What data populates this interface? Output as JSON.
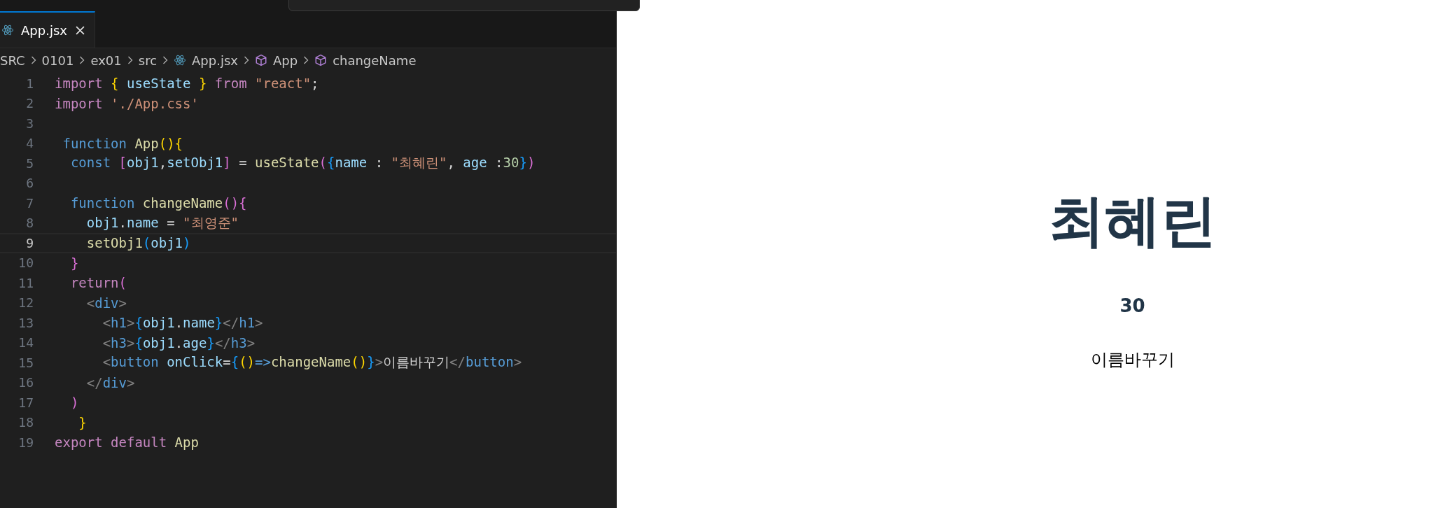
{
  "editor": {
    "tabs": [
      {
        "label": "App.jsx",
        "selected": true
      }
    ],
    "breadcrumb": [
      {
        "label": "SRC",
        "kind": "folder"
      },
      {
        "label": "0101",
        "kind": "folder"
      },
      {
        "label": "ex01",
        "kind": "folder"
      },
      {
        "label": "src",
        "kind": "folder"
      },
      {
        "label": "App.jsx",
        "kind": "file"
      },
      {
        "label": "App",
        "kind": "symbol"
      },
      {
        "label": "changeName",
        "kind": "symbol"
      }
    ],
    "lines": [
      {
        "number": "1",
        "current": false,
        "tokens": [
          {
            "kind": "kw",
            "text": "import "
          },
          {
            "kind": "b1",
            "text": "{ "
          },
          {
            "kind": "var",
            "text": "useState "
          },
          {
            "kind": "b1",
            "text": "} "
          },
          {
            "kind": "kw",
            "text": "from "
          },
          {
            "kind": "str",
            "text": "\"react\""
          },
          {
            "kind": "p",
            "text": ";"
          }
        ]
      },
      {
        "number": "2",
        "current": false,
        "tokens": [
          {
            "kind": "kw",
            "text": "import "
          },
          {
            "kind": "str",
            "text": "'./App.css'"
          }
        ]
      },
      {
        "number": "3",
        "current": false
      },
      {
        "number": "4",
        "current": false,
        "tokens": [
          {
            "kind": "decl",
            "text": " function "
          },
          {
            "kind": "fn",
            "text": "App"
          },
          {
            "kind": "b1",
            "text": "(){"
          }
        ]
      },
      {
        "number": "5",
        "current": false,
        "tokens": [
          {
            "kind": "decl",
            "text": "  const "
          },
          {
            "kind": "b2",
            "text": "["
          },
          {
            "kind": "var",
            "text": "obj1"
          },
          {
            "kind": "p",
            "text": ","
          },
          {
            "kind": "var",
            "text": "setObj1"
          },
          {
            "kind": "b2",
            "text": "]"
          },
          {
            "kind": "p",
            "text": " = "
          },
          {
            "kind": "fn",
            "text": "useState"
          },
          {
            "kind": "b2",
            "text": "("
          },
          {
            "kind": "b3",
            "text": "{"
          },
          {
            "kind": "var",
            "text": "name"
          },
          {
            "kind": "p",
            "text": " : "
          },
          {
            "kind": "str",
            "text": "\"최혜린\""
          },
          {
            "kind": "p",
            "text": ", "
          },
          {
            "kind": "var",
            "text": "age"
          },
          {
            "kind": "p",
            "text": " :"
          },
          {
            "kind": "num",
            "text": "30"
          },
          {
            "kind": "b3",
            "text": "}"
          },
          {
            "kind": "b2",
            "text": ")"
          }
        ]
      },
      {
        "number": "6",
        "current": false
      },
      {
        "number": "7",
        "current": false,
        "tokens": [
          {
            "kind": "decl",
            "text": "  function "
          },
          {
            "kind": "fn",
            "text": "changeName"
          },
          {
            "kind": "b2",
            "text": "(){"
          }
        ]
      },
      {
        "number": "8",
        "current": false,
        "tokens": [
          {
            "kind": "var",
            "text": "    obj1"
          },
          {
            "kind": "p",
            "text": "."
          },
          {
            "kind": "var",
            "text": "name"
          },
          {
            "kind": "p",
            "text": " = "
          },
          {
            "kind": "str",
            "text": "\"최영준\""
          }
        ]
      },
      {
        "number": "9",
        "current": true,
        "tokens": [
          {
            "kind": "fn",
            "text": "    setObj1"
          },
          {
            "kind": "b3",
            "text": "("
          },
          {
            "kind": "var",
            "text": "obj1"
          },
          {
            "kind": "b3",
            "text": ")"
          }
        ]
      },
      {
        "number": "10",
        "current": false,
        "tokens": [
          {
            "kind": "b2",
            "text": "  }"
          }
        ]
      },
      {
        "number": "11",
        "current": false,
        "tokens": [
          {
            "kind": "kw",
            "text": "  return"
          },
          {
            "kind": "b2",
            "text": "("
          }
        ]
      },
      {
        "number": "12",
        "current": false,
        "tokens": [
          {
            "kind": "br",
            "text": "    <"
          },
          {
            "kind": "tag",
            "text": "div"
          },
          {
            "kind": "br",
            "text": ">"
          }
        ]
      },
      {
        "number": "13",
        "current": false,
        "tokens": [
          {
            "kind": "br",
            "text": "      <"
          },
          {
            "kind": "tag",
            "text": "h1"
          },
          {
            "kind": "br",
            "text": ">"
          },
          {
            "kind": "b3",
            "text": "{"
          },
          {
            "kind": "var",
            "text": "obj1"
          },
          {
            "kind": "p",
            "text": "."
          },
          {
            "kind": "var",
            "text": "name"
          },
          {
            "kind": "b3",
            "text": "}"
          },
          {
            "kind": "br",
            "text": "</"
          },
          {
            "kind": "tag",
            "text": "h1"
          },
          {
            "kind": "br",
            "text": ">"
          }
        ]
      },
      {
        "number": "14",
        "current": false,
        "tokens": [
          {
            "kind": "br",
            "text": "      <"
          },
          {
            "kind": "tag",
            "text": "h3"
          },
          {
            "kind": "br",
            "text": ">"
          },
          {
            "kind": "b3",
            "text": "{"
          },
          {
            "kind": "var",
            "text": "obj1"
          },
          {
            "kind": "p",
            "text": "."
          },
          {
            "kind": "var",
            "text": "age"
          },
          {
            "kind": "b3",
            "text": "}"
          },
          {
            "kind": "br",
            "text": "</"
          },
          {
            "kind": "tag",
            "text": "h3"
          },
          {
            "kind": "br",
            "text": ">"
          }
        ]
      },
      {
        "number": "15",
        "current": false,
        "tokens": [
          {
            "kind": "br",
            "text": "      <"
          },
          {
            "kind": "tag",
            "text": "button "
          },
          {
            "kind": "var",
            "text": "onClick"
          },
          {
            "kind": "p",
            "text": "="
          },
          {
            "kind": "b3",
            "text": "{"
          },
          {
            "kind": "b1",
            "text": "()"
          },
          {
            "kind": "decl",
            "text": "=>"
          },
          {
            "kind": "fn",
            "text": "changeName"
          },
          {
            "kind": "b1",
            "text": "()"
          },
          {
            "kind": "b3",
            "text": "}"
          },
          {
            "kind": "br",
            "text": ">"
          },
          {
            "kind": "p",
            "text": "이름바꾸기"
          },
          {
            "kind": "br",
            "text": "</"
          },
          {
            "kind": "tag",
            "text": "button"
          },
          {
            "kind": "br",
            "text": ">"
          }
        ]
      },
      {
        "number": "16",
        "current": false,
        "tokens": [
          {
            "kind": "br",
            "text": "    </"
          },
          {
            "kind": "tag",
            "text": "div"
          },
          {
            "kind": "br",
            "text": ">"
          }
        ]
      },
      {
        "number": "17",
        "current": false,
        "tokens": [
          {
            "kind": "b2",
            "text": "  )"
          }
        ]
      },
      {
        "number": "18",
        "current": false,
        "tokens": [
          {
            "kind": "b1",
            "text": "   }"
          }
        ]
      },
      {
        "number": "19",
        "current": false,
        "tokens": [
          {
            "kind": "kw",
            "text": "export "
          },
          {
            "kind": "kw",
            "text": "default "
          },
          {
            "kind": "fn",
            "text": "App"
          }
        ]
      }
    ]
  },
  "preview": {
    "heading": "최혜린",
    "age": "30",
    "button": "이름바꾸기"
  }
}
